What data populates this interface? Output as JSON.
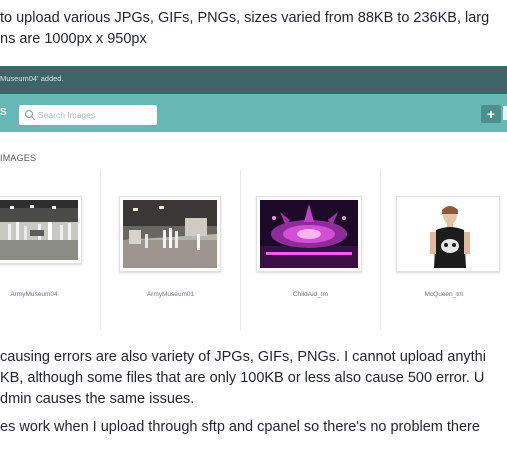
{
  "question_top": {
    "lines": [
      "to upload various JPGs, GIFs, PNGs, sizes varied from 88KB to 236KB, larg",
      "ns are 1000px x 950px"
    ]
  },
  "screenshot": {
    "notice": "Museum04' added.",
    "toolbar": {
      "title_fragment": "S",
      "search_placeholder": "Search Images",
      "add_symbol": "+"
    },
    "section_title": "IMAGES",
    "images": [
      {
        "caption": "ArmyMuseum04"
      },
      {
        "caption": "ArmyMuseum01"
      },
      {
        "caption": "ChildAid_tm"
      },
      {
        "caption": "McQueen_tm"
      }
    ]
  },
  "question_bottom": {
    "lines": [
      "causing errors are also variety of JPGs, GIFs, PNGs. I cannot upload anythi",
      "KB, although some files that are only 100KB or less also cause 500 error. U",
      "dmin causes the same issues."
    ]
  },
  "question_last": {
    "lines": [
      "es work when I upload through sftp and cpanel so there's no problem there"
    ]
  },
  "colors": {
    "notice_bar": "#3d6466",
    "toolbar": "#67b7b4",
    "add_button": "#4d8f8c"
  }
}
